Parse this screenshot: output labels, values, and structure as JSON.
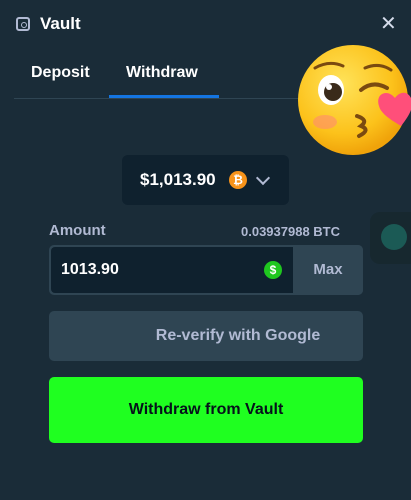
{
  "header": {
    "title": "Vault",
    "close_icon": "close-icon",
    "vault_icon": "vault-icon"
  },
  "tabs": [
    {
      "label": "Deposit",
      "active": false
    },
    {
      "label": "Withdraw",
      "active": true
    }
  ],
  "currency_selector": {
    "value": "$1,013.90",
    "coin_icon": "bitcoin-icon",
    "coin_glyph": "₿"
  },
  "amount": {
    "label": "Amount",
    "crypto_equivalent": "0.03937988 BTC",
    "input_value": "1013.90",
    "currency_icon": "dollar-icon",
    "currency_glyph": "$",
    "max_label": "Max"
  },
  "buttons": {
    "reverify_label": "Re-verify with Google",
    "withdraw_label": "Withdraw from Vault"
  },
  "colors": {
    "background": "#1a2c38",
    "input_bg": "#0f212e",
    "secondary_bg": "#2f4553",
    "accent_blue": "#1475e1",
    "primary_green": "#1fff20",
    "muted_text": "#b1bad3"
  }
}
